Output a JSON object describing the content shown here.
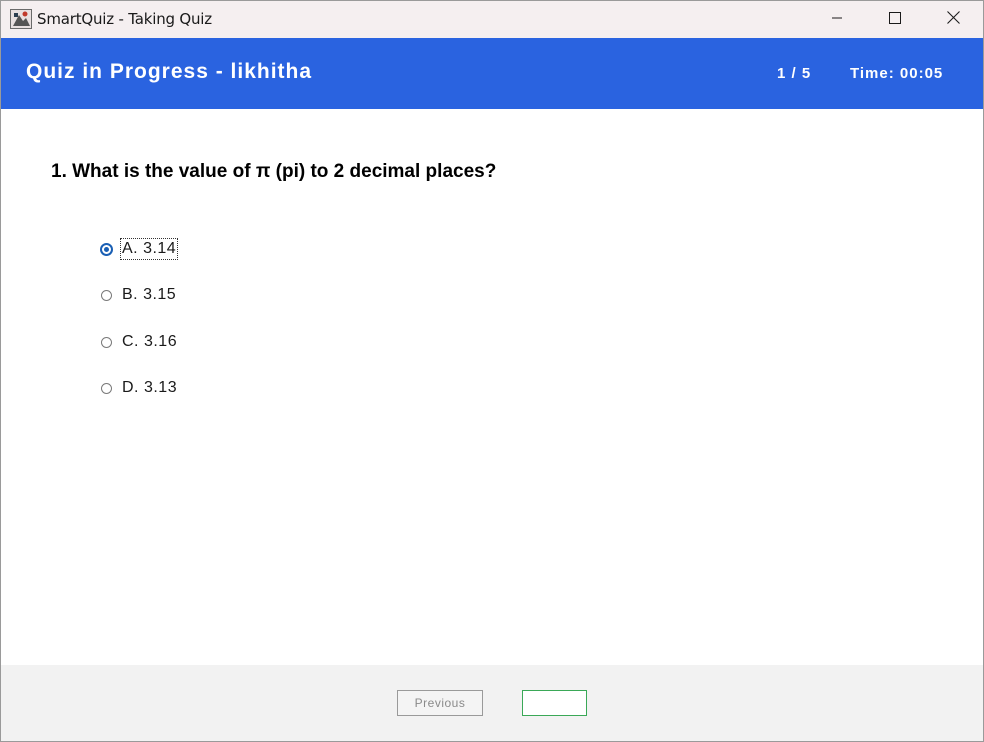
{
  "window": {
    "title": "SmartQuiz - Taking Quiz"
  },
  "header": {
    "title": "Quiz in Progress - likhitha",
    "progress": "1 / 5",
    "timer": "Time: 00:05",
    "background": "#2a63e0"
  },
  "question": {
    "text": "1. What is the value of π (pi) to 2 decimal places?",
    "options": [
      {
        "label": "A. 3.14",
        "selected": true
      },
      {
        "label": "B. 3.15",
        "selected": false
      },
      {
        "label": "C. 3.16",
        "selected": false
      },
      {
        "label": "D. 3.13",
        "selected": false
      }
    ]
  },
  "footer": {
    "previous_label": "Previous",
    "next_label": "",
    "previous_enabled": false,
    "next_accent": "#3aa857"
  },
  "icons": {
    "app": "java-app-icon",
    "minimize": "minimize-icon",
    "maximize": "maximize-icon",
    "close": "close-icon"
  }
}
